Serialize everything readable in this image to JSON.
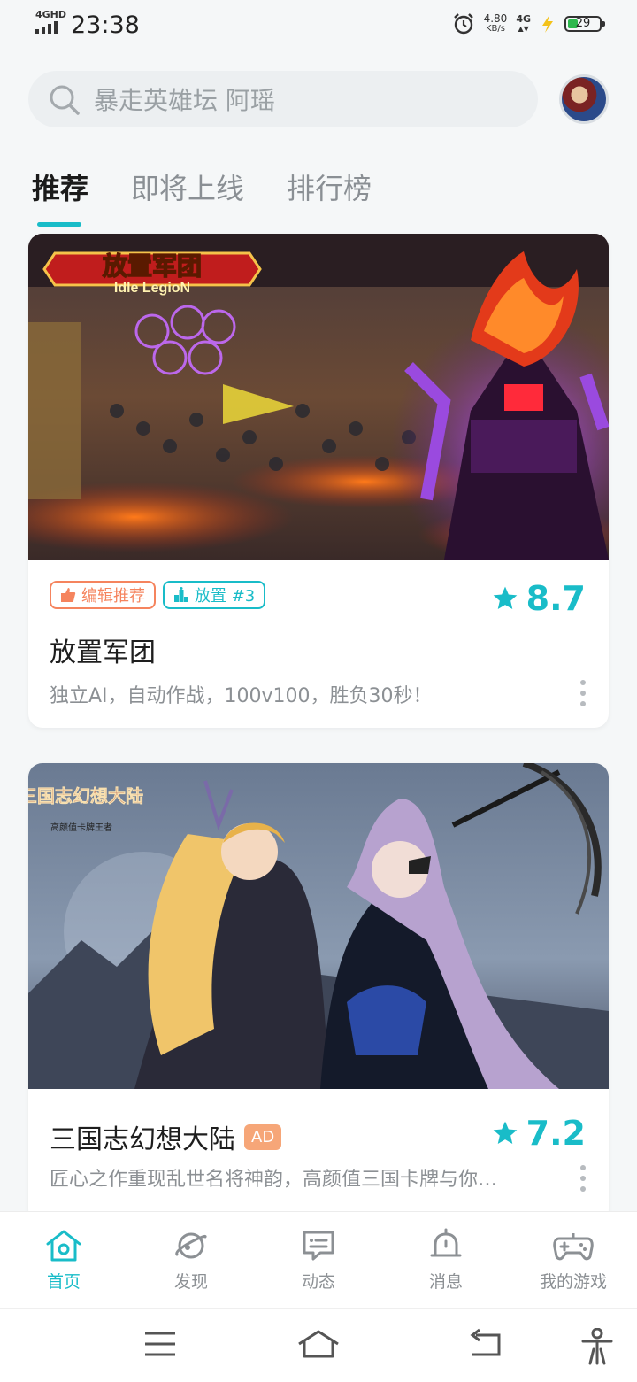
{
  "status": {
    "network": "4GHD",
    "time": "23:38",
    "speed_value": "4.80",
    "speed_unit": "KB/s",
    "signal": "4G",
    "battery": "29"
  },
  "search": {
    "placeholder": "暴走英雄坛 阿瑶"
  },
  "tabs": [
    {
      "label": "推荐",
      "active": true
    },
    {
      "label": "即将上线",
      "active": false
    },
    {
      "label": "排行榜",
      "active": false
    }
  ],
  "cards": [
    {
      "banner_logo": "放置军团",
      "banner_logo_sub": "Idle LegioN",
      "badges": [
        "编辑推荐",
        "放置 #3"
      ],
      "rating": "8.7",
      "title": "放置军团",
      "desc": "独立AI，自动作战，100v100，胜负30秒！"
    },
    {
      "banner_logo": "三国志幻想大陆",
      "banner_logo_sub": "高颜值卡牌王者",
      "ad": "AD",
      "rating": "7.2",
      "title": "三国志幻想大陆",
      "desc": "匠心之作重现乱世名将神韵，高颜值三国卡牌与你…"
    }
  ],
  "nav": [
    {
      "label": "首页",
      "icon": "home-icon",
      "active": true
    },
    {
      "label": "发现",
      "icon": "planet-icon",
      "active": false
    },
    {
      "label": "动态",
      "icon": "message-icon",
      "active": false
    },
    {
      "label": "消息",
      "icon": "bell-icon",
      "active": false
    },
    {
      "label": "我的游戏",
      "icon": "gamepad-icon",
      "active": false
    }
  ],
  "colors": {
    "accent": "#19bcc8",
    "orange": "#f5845e",
    "ad": "#f6a678"
  }
}
